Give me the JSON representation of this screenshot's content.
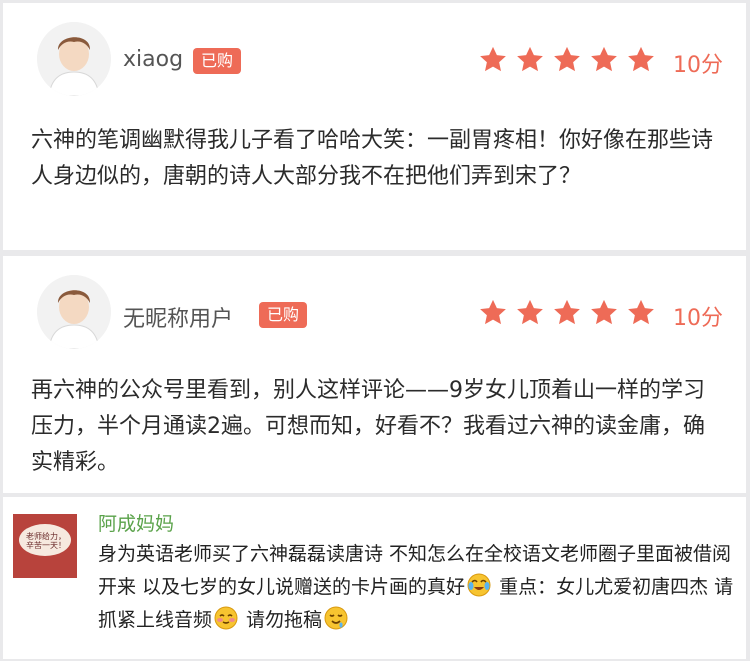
{
  "reviews": [
    {
      "username": "xiaog",
      "badge": "已购",
      "stars": 5,
      "score": "10分",
      "text": "六神的笔调幽默得我儿子看了哈哈大笑：一副胃疼相！你好像在那些诗人身边似的，唐朝的诗人大部分我不在把他们弄到宋了？"
    },
    {
      "username": "无昵称用户",
      "badge": "已购",
      "stars": 5,
      "score": "10分",
      "text": "再六神的公众号里看到，别人这样评论——9岁女儿顶着山一样的学习压力，半个月通读2遍。可想而知，好看不？我看过六神的读金庸，确实精彩。"
    }
  ],
  "wechat_comment": {
    "thumb_text": "老师给力，辛苦一天！",
    "name": "阿成妈妈",
    "text_part1": "身为英语老师买了六神磊磊读唐诗 不知怎么在全校语文老师圈子里面被借阅开来 以及七岁的女儿说赠送的卡片画的真好",
    "text_part2": " 重点：女儿尤爱初唐四杰 请抓紧上线音频",
    "text_part3": " 请勿拖稿",
    "emoji1": "crying-laughing-emoji",
    "emoji2": "blushing-emoji",
    "emoji3": "drooling-emoji"
  },
  "colors": {
    "accent": "#ee6b57",
    "wechat_name": "#5aa24a"
  }
}
